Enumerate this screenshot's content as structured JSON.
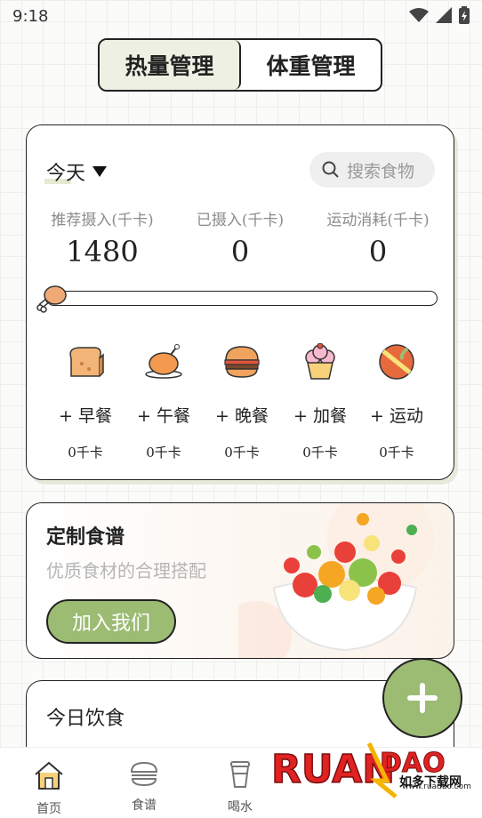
{
  "status_bar": {
    "time": "9:18"
  },
  "tabs": [
    {
      "label": "热量管理",
      "active": true
    },
    {
      "label": "体重管理",
      "active": false
    }
  ],
  "calorie_card": {
    "date_selector": "今天",
    "search_placeholder": "搜索食物",
    "stats": [
      {
        "label": "推荐摄入(千卡)",
        "value": "1480"
      },
      {
        "label": "已摄入(千卡)",
        "value": "0"
      },
      {
        "label": "运动消耗(千卡)",
        "value": "0"
      }
    ],
    "progress_fraction": 0,
    "meals": [
      {
        "icon": "toast-icon",
        "label": "+ 早餐",
        "kcal": "0千卡"
      },
      {
        "icon": "roast-chicken-icon",
        "label": "+ 午餐",
        "kcal": "0千卡"
      },
      {
        "icon": "burger-icon",
        "label": "+ 晚餐",
        "kcal": "0千卡"
      },
      {
        "icon": "cupcake-icon",
        "label": "+ 加餐",
        "kcal": "0千卡"
      },
      {
        "icon": "ball-icon",
        "label": "+ 运动",
        "kcal": "0千卡"
      }
    ]
  },
  "recipe_card": {
    "title": "定制食谱",
    "subtitle": "优质食材的合理搭配",
    "button": "加入我们"
  },
  "diet_card": {
    "title": "今日饮食"
  },
  "bottom_nav": [
    {
      "label": "首页",
      "icon": "home-icon"
    },
    {
      "label": "食谱",
      "icon": "burger-outline-icon"
    },
    {
      "label": "喝水",
      "icon": "cup-icon"
    }
  ],
  "watermark": {
    "brand": "RUANDAO",
    "tagline": "如多下载网",
    "site": "www.ruaduo.com"
  },
  "colors": {
    "accent_green": "#9cbb73",
    "active_tab_bg": "#eef0e3",
    "border": "#222222"
  }
}
